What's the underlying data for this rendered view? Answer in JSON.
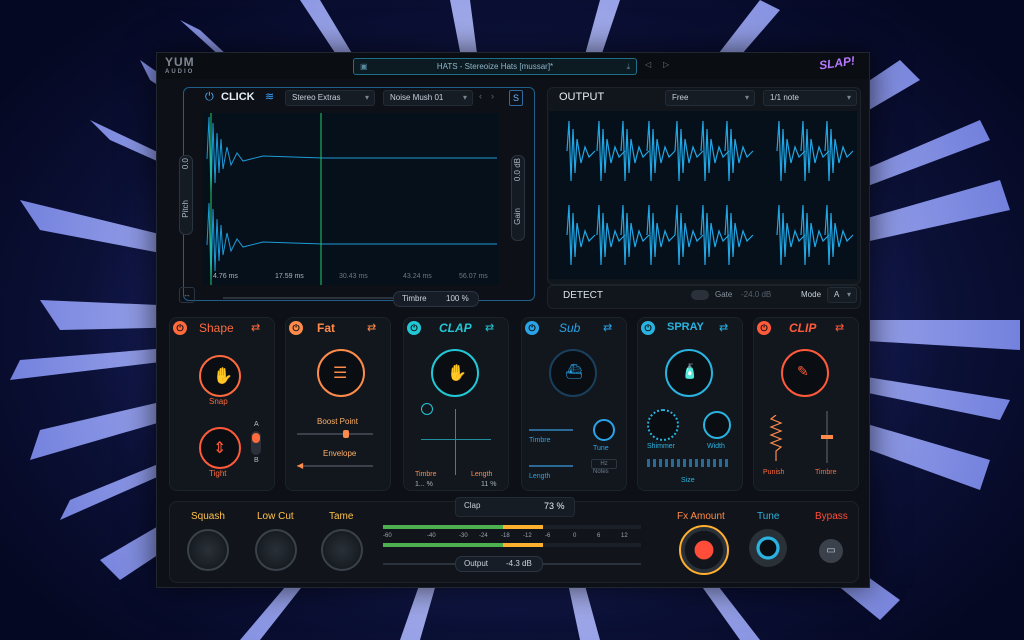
{
  "header": {
    "logo": "YUM",
    "logo_sub": "AUDIO",
    "preset_name": "HATS - Stereoize Hats [mussar]*",
    "prev": "◁",
    "next": "▷",
    "brand": "SLAP!"
  },
  "click_panel": {
    "title": "CLICK",
    "preset_a": "Stereo Extras",
    "preset_b": "Noise Mush 01",
    "solo": "S",
    "pitch_label": "Pitch",
    "pitch_value": "0.0",
    "gain_label": "Gain",
    "gain_value": "0.0 dB",
    "times": [
      "4.76 ms",
      "17.59 ms",
      "30.43 ms",
      "43.24 ms",
      "56.07 ms"
    ],
    "timbre_label": "Timbre",
    "timbre_value": "100 %"
  },
  "output_panel": {
    "title": "OUTPUT",
    "sync": "Free",
    "division": "1/1 note",
    "detect": "DETECT",
    "gate_label": "Gate",
    "gate_value": "-24.0 dB",
    "mode_label": "Mode",
    "mode_value": "A"
  },
  "modules": [
    {
      "name": "Shape",
      "color": "#ff6a3d",
      "icon": "snap-hand-icon"
    },
    {
      "name": "Fat",
      "color": "#ff8b4a",
      "icon": "burger-icon"
    },
    {
      "name": "CLAP",
      "color": "#22c7d6",
      "icon": "clap-hand-icon"
    },
    {
      "name": "Sub",
      "color": "#2aa3e8",
      "icon": "submarine-icon"
    },
    {
      "name": "SPRAY",
      "color": "#2ab3e0",
      "icon": "spray-can-icon"
    },
    {
      "name": "CLIP",
      "color": "#ff5a3a",
      "icon": "clip-pen-icon"
    }
  ],
  "shape": {
    "snap": "Snap",
    "tight": "Tight",
    "a": "A",
    "b": "B"
  },
  "fat": {
    "boost_point": "Boost Point",
    "envelope": "Envelope"
  },
  "clap": {
    "timbre": "Timbre",
    "timbre_val": "1... %",
    "length": "Length",
    "length_val": "11 %"
  },
  "sub": {
    "timbre": "Timbre",
    "length": "Length",
    "tune": "Tune",
    "notes": "Notes",
    "notes_btn": "Hz"
  },
  "spray": {
    "shimmer": "Shimmer",
    "width": "Width",
    "size": "Size"
  },
  "clip": {
    "punish": "Punish",
    "timbre": "Timbre"
  },
  "bottom": {
    "squash": "Squash",
    "low_cut": "Low Cut",
    "tame": "Tame",
    "clap_label": "Clap",
    "clap_value": "73 %",
    "meter_ticks": [
      "-60",
      "-40",
      "-30",
      "-24",
      "-18",
      "-12",
      "-6",
      "0",
      "6",
      "12"
    ],
    "output_label": "Output",
    "output_value": "-4.3 dB",
    "fx_amount": "Fx Amount",
    "tune": "Tune",
    "bypass": "Bypass",
    "meter_level": 0.62
  },
  "colors": {
    "accent": "#22a6e0",
    "orange": "#ffb02e",
    "red": "#ff4d3a",
    "cyan": "#22c7d6"
  }
}
